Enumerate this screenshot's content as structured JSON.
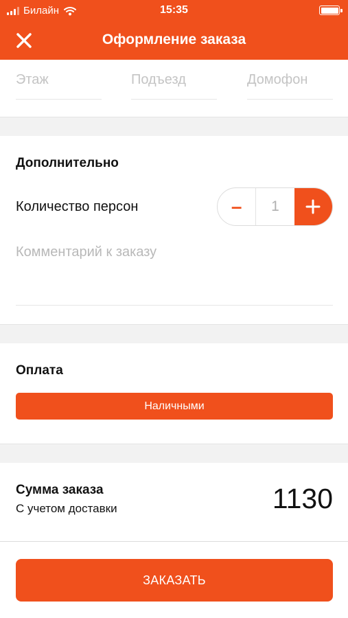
{
  "status_bar": {
    "carrier": "Билайн",
    "time": "15:35"
  },
  "nav": {
    "title": "Оформление заказа"
  },
  "address": {
    "floor_placeholder": "Этаж",
    "entrance_placeholder": "Подъезд",
    "intercom_placeholder": "Домофон"
  },
  "additional": {
    "title": "Дополнительно",
    "persons_label": "Количество персон",
    "persons_value": "1",
    "minus": "–",
    "comment_placeholder": "Комментарий к заказу"
  },
  "payment": {
    "title": "Оплата",
    "method": "Наличными"
  },
  "summary": {
    "title": "Сумма заказа",
    "subtitle": "С учетом доставки",
    "amount": "1130"
  },
  "actions": {
    "order": "ЗАКАЗАТЬ"
  },
  "colors": {
    "accent": "#f0501c",
    "separator": "#f2f2f2"
  }
}
